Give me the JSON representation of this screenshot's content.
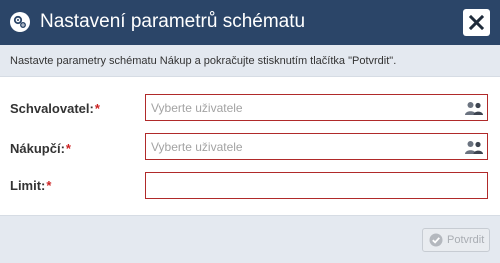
{
  "dialog": {
    "title": "Nastavení parametrů schématu",
    "description": "Nastavte parametry schématu Nákup a pokračujte stisknutím tlačítka \"Potvrdit\"."
  },
  "form": {
    "fields": [
      {
        "label": "Schvalovatel:",
        "required_mark": "*",
        "placeholder": "Vyberte uživatele",
        "value": "",
        "icon": "users-icon"
      },
      {
        "label": "Nákupčí:",
        "required_mark": "*",
        "placeholder": "Vyberte uživatele",
        "value": "",
        "icon": "users-icon"
      },
      {
        "label": "Limit:",
        "required_mark": "*",
        "placeholder": "",
        "value": ""
      }
    ]
  },
  "footer": {
    "confirm_label": "Potvrdit",
    "confirm_icon": "check-circle-icon"
  },
  "colors": {
    "titlebar_bg": "#2b4568",
    "infobar_bg": "#e4e9f0",
    "field_border_error": "#b02a2a",
    "required_mark": "#cc2222"
  }
}
